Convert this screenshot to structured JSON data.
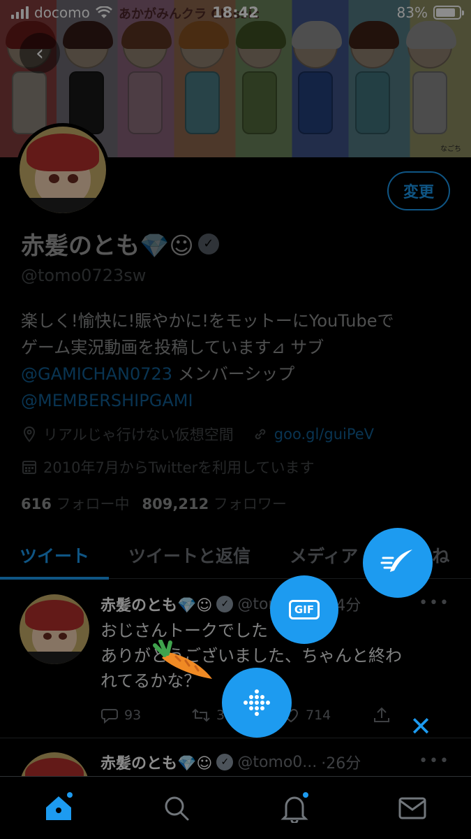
{
  "status_bar": {
    "carrier": "docomo",
    "time": "18:42",
    "battery": "83%",
    "battery_level": 0.83
  },
  "banner": {
    "title": "あかがみんクラ Classic",
    "credit": "なごち"
  },
  "profile": {
    "name": "赤髪のとも💎☺",
    "handle": "@tomo0723sw",
    "edit_label": "変更",
    "bio_line1": "楽しく!愉快に!賑やかに!をモットーにYouTubeで",
    "bio_line2": "ゲーム実況動画を投稿しています⊿ サブ",
    "bio_link1": "@GAMICHAN0723",
    "bio_mid": " メンバーシップ",
    "bio_link2": "@MEMBERSHIPGAMI",
    "location": "リアルじゃ行けない仮想空間",
    "url": "goo.gl/guiPeV",
    "joined": "2010年7月からTwitterを利用しています",
    "following_count": "616",
    "following_label": "フォロー中",
    "followers_count": "809,212",
    "followers_label": "フォロワー"
  },
  "tabs": [
    "ツイート",
    "ツイートと返信",
    "メディア",
    "いいね"
  ],
  "tweets": [
    {
      "name": "赤髪のとも💎☺",
      "handle": "@tomo07...",
      "time": "·4分",
      "line1": "おじさんトークでした",
      "line2": "ありがとうございました、ちゃんと終わ",
      "line3": "れてるかな？",
      "replies": "93",
      "retweets": "36",
      "likes": "714"
    },
    {
      "name": "赤髪のとも💎☺",
      "handle": "@tomo0...",
      "time": "·26分"
    }
  ],
  "fab": {
    "gif_label": "GIF"
  },
  "colors": {
    "accent": "#1d9bf0",
    "background": "#000000",
    "muted": "#71767b"
  }
}
